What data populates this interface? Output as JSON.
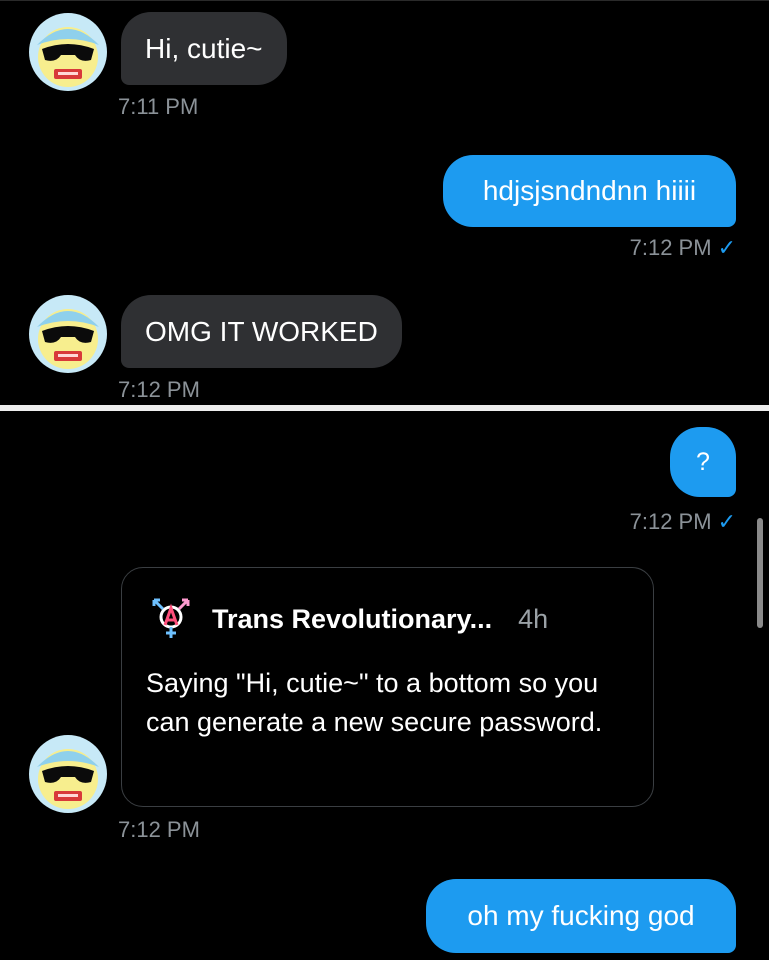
{
  "colors": {
    "background": "#000000",
    "incoming_bubble": "#2f3033",
    "outgoing_bubble": "#1d9bf0",
    "timestamp": "#8b9298",
    "read_check": "#1d9bf0"
  },
  "icons": {
    "avatar": "cartoon-face-with-sunglasses-avatar",
    "read_receipt": "checkmark-icon",
    "tweet_author": "trans-anarchy-symbol-icon"
  },
  "panel_top": {
    "messages": [
      {
        "direction": "incoming",
        "text": "Hi, cutie~",
        "time": "7:11 PM"
      },
      {
        "direction": "outgoing",
        "text": "hdjsjsndndnn hiiii",
        "time": "7:12 PM",
        "check": "✓"
      },
      {
        "direction": "incoming",
        "text": "OMG IT WORKED",
        "time": "7:12 PM"
      }
    ]
  },
  "panel_bottom": {
    "messages": [
      {
        "direction": "outgoing",
        "text": "?",
        "time": "7:12 PM",
        "check": "✓"
      },
      {
        "direction": "incoming",
        "type": "shared-tweet",
        "tweet": {
          "author": "Trans Revolutionary...",
          "age": "4h",
          "body": "Saying \"Hi, cutie~\" to a bottom so you can generate a new secure password."
        },
        "time": "7:12 PM"
      },
      {
        "direction": "outgoing",
        "text": "oh my fucking god"
      }
    ]
  }
}
